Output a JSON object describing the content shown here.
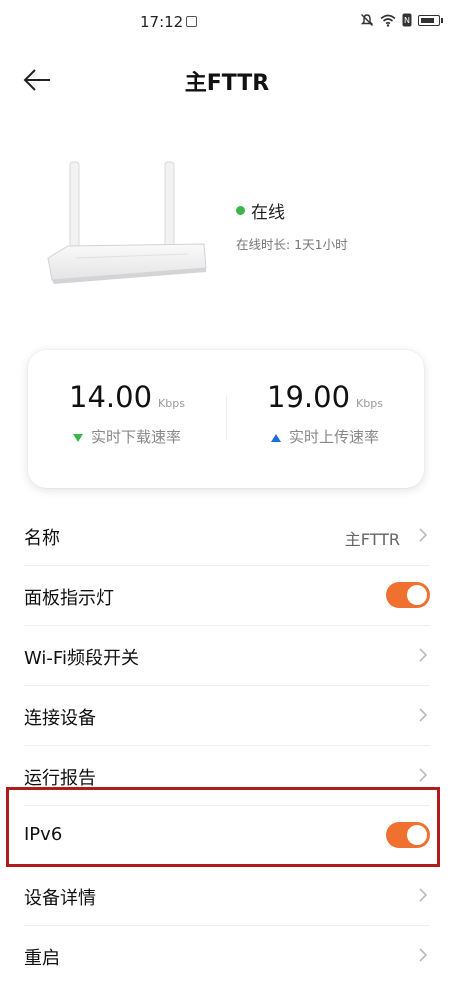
{
  "status_bar": {
    "time": "17:12",
    "icons": [
      "sim-icon",
      "mute-icon",
      "wifi-icon",
      "nfc-icon",
      "battery-icon"
    ]
  },
  "header": {
    "title": "主FTTR",
    "back_icon": "arrow-left-icon"
  },
  "device": {
    "status": "在线",
    "status_color": "#3bb54a",
    "online_duration": "在线时长: 1天1小时"
  },
  "speed": {
    "download": {
      "value": "14.00",
      "unit": "Kbps",
      "label": "实时下载速率",
      "color": "#3bb54a"
    },
    "upload": {
      "value": "19.00",
      "unit": "Kbps",
      "label": "实时上传速率",
      "color": "#1e6fd9"
    }
  },
  "settings": {
    "name_label": "名称",
    "name_value": "主FTTR",
    "panel_light_label": "面板指示灯",
    "panel_light_on": true,
    "wifi_band_label": "Wi-Fi频段开关",
    "connected_devices_label": "连接设备",
    "run_report_label": "运行报告",
    "ipv6_label": "IPv6",
    "ipv6_on": true,
    "device_details_label": "设备详情",
    "restart_label": "重启"
  },
  "colors": {
    "toggle_on": "#f07030",
    "highlight_border": "#b01c1c"
  }
}
